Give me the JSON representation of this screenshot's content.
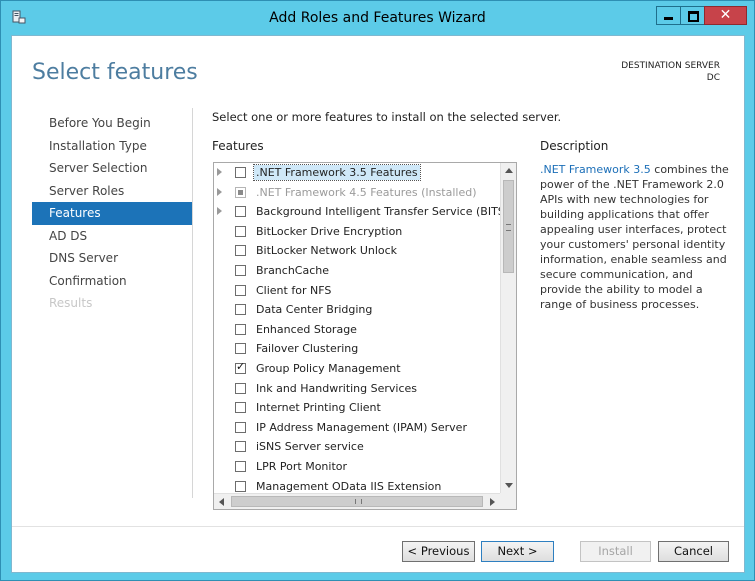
{
  "window": {
    "title": "Add Roles and Features Wizard",
    "close_glyph": "✕"
  },
  "header": {
    "page_title": "Select features",
    "destination_label": "DESTINATION SERVER",
    "destination_server": "DC"
  },
  "nav": {
    "items": [
      {
        "label": "Before You Begin",
        "state": "normal"
      },
      {
        "label": "Installation Type",
        "state": "normal"
      },
      {
        "label": "Server Selection",
        "state": "normal"
      },
      {
        "label": "Server Roles",
        "state": "normal"
      },
      {
        "label": "Features",
        "state": "active"
      },
      {
        "label": "AD DS",
        "state": "normal"
      },
      {
        "label": "DNS Server",
        "state": "normal"
      },
      {
        "label": "Confirmation",
        "state": "normal"
      },
      {
        "label": "Results",
        "state": "disabled"
      }
    ]
  },
  "main": {
    "instruction": "Select one or more features to install on the selected server.",
    "features_label": "Features",
    "features": [
      {
        "label": ".NET Framework 3.5 Features",
        "expandable": true,
        "checked": false,
        "selected": true,
        "disabled": false
      },
      {
        "label": ".NET Framework 4.5 Features (Installed)",
        "expandable": true,
        "checked": "partial",
        "selected": false,
        "disabled": true
      },
      {
        "label": "Background Intelligent Transfer Service (BITS)",
        "expandable": true,
        "checked": false,
        "selected": false,
        "disabled": false
      },
      {
        "label": "BitLocker Drive Encryption",
        "expandable": false,
        "checked": false,
        "selected": false,
        "disabled": false
      },
      {
        "label": "BitLocker Network Unlock",
        "expandable": false,
        "checked": false,
        "selected": false,
        "disabled": false
      },
      {
        "label": "BranchCache",
        "expandable": false,
        "checked": false,
        "selected": false,
        "disabled": false
      },
      {
        "label": "Client for NFS",
        "expandable": false,
        "checked": false,
        "selected": false,
        "disabled": false
      },
      {
        "label": "Data Center Bridging",
        "expandable": false,
        "checked": false,
        "selected": false,
        "disabled": false
      },
      {
        "label": "Enhanced Storage",
        "expandable": false,
        "checked": false,
        "selected": false,
        "disabled": false
      },
      {
        "label": "Failover Clustering",
        "expandable": false,
        "checked": false,
        "selected": false,
        "disabled": false
      },
      {
        "label": "Group Policy Management",
        "expandable": false,
        "checked": true,
        "selected": false,
        "disabled": false
      },
      {
        "label": "Ink and Handwriting Services",
        "expandable": false,
        "checked": false,
        "selected": false,
        "disabled": false
      },
      {
        "label": "Internet Printing Client",
        "expandable": false,
        "checked": false,
        "selected": false,
        "disabled": false
      },
      {
        "label": "IP Address Management (IPAM) Server",
        "expandable": false,
        "checked": false,
        "selected": false,
        "disabled": false
      },
      {
        "label": "iSNS Server service",
        "expandable": false,
        "checked": false,
        "selected": false,
        "disabled": false
      },
      {
        "label": "LPR Port Monitor",
        "expandable": false,
        "checked": false,
        "selected": false,
        "disabled": false
      },
      {
        "label": "Management OData IIS Extension",
        "expandable": false,
        "checked": false,
        "selected": false,
        "disabled": false
      }
    ]
  },
  "description": {
    "heading": "Description",
    "link_text": ".NET Framework 3.5",
    "body": " combines the power of the .NET Framework 2.0 APIs with new technologies for building applications that offer appealing user interfaces, protect your customers' personal identity information, enable seamless and secure communication, and provide the ability to model a range of business processes."
  },
  "footer": {
    "previous_label": "< Previous",
    "next_label": "Next >",
    "install_label": "Install",
    "cancel_label": "Cancel"
  }
}
